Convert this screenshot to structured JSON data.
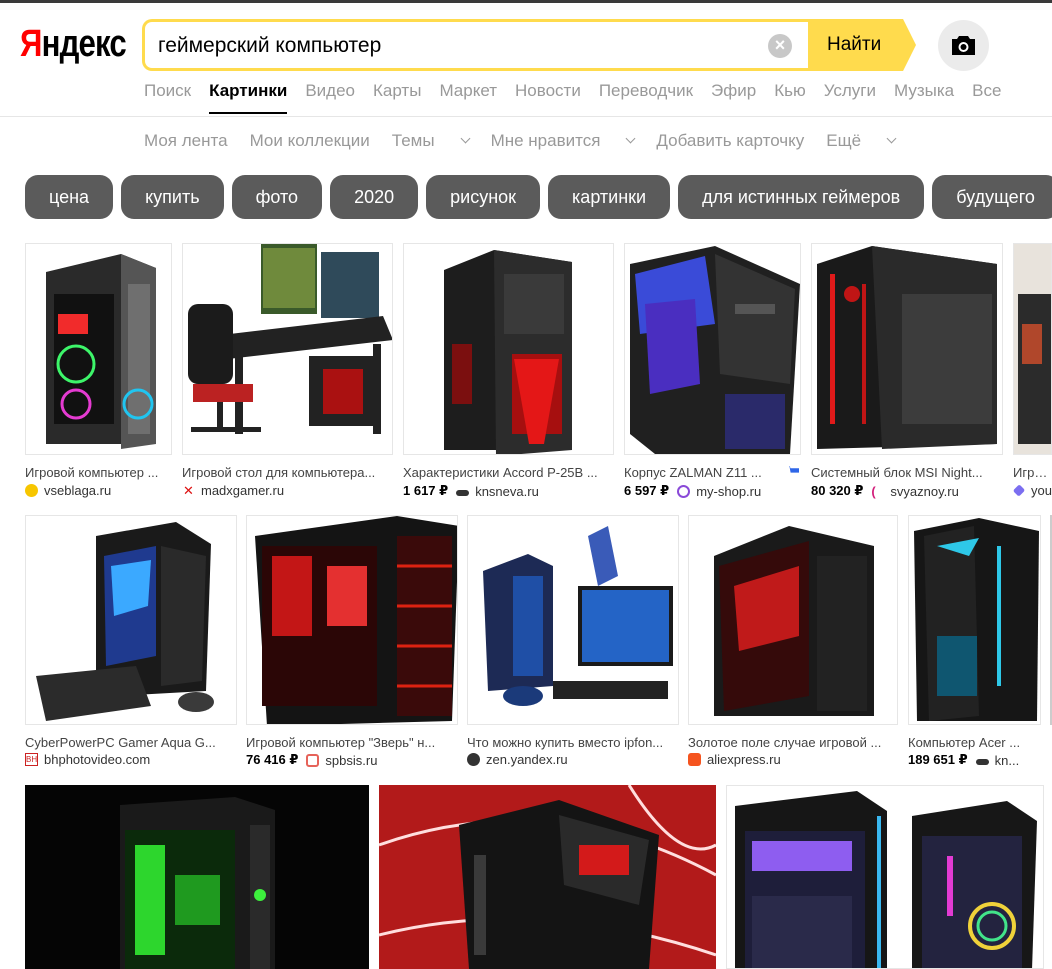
{
  "logo": {
    "first": "Я",
    "rest": "ндекс"
  },
  "search": {
    "query": "геймерский компьютер",
    "find_label": "Найти",
    "clear_glyph": "×"
  },
  "services": [
    "Поиск",
    "Картинки",
    "Видео",
    "Карты",
    "Маркет",
    "Новости",
    "Переводчик",
    "Эфир",
    "Кью",
    "Услуги",
    "Музыка",
    "Все"
  ],
  "subnav": {
    "feed": "Моя лента",
    "collections": "Мои коллекции",
    "themes": "Темы",
    "likes": "Мне нравится",
    "add_card": "Добавить карточку",
    "more": "Ещё"
  },
  "chips": [
    "цена",
    "купить",
    "фото",
    "2020",
    "рисунок",
    "картинки",
    "для истинных геймеров",
    "будущего"
  ],
  "images": {
    "r1c1": {
      "caption": "Игровой компьютер ...",
      "source": "vseblaga.ru"
    },
    "r1c2": {
      "caption": "Игровой стол для компьютера...",
      "source": "madxgamer.ru"
    },
    "r1c3": {
      "caption": "Характеристики Accord P-25B ...",
      "price": "1 617 ₽",
      "source": "knsneva.ru"
    },
    "r1c4": {
      "caption": "Корпус ZALMAN Z11 ...",
      "price": "6 597 ₽",
      "source": "my-shop.ru"
    },
    "r1c5": {
      "caption": "Системный блок MSI Night...",
      "price": "80 320 ₽",
      "source": "svyaznoy.ru"
    },
    "r1c6": {
      "caption": "Игрово",
      "source": "you"
    },
    "r2c1": {
      "caption": "CyberPowerPC Gamer Aqua G...",
      "source": "bhphotovideo.com",
      "fav_text": "BH"
    },
    "r2c2": {
      "caption": "Игровой компьютер \"Зверь\" н...",
      "price": "76 416 ₽",
      "source": "spbsis.ru"
    },
    "r2c3": {
      "caption": "Что можно купить вместо ipfon...",
      "source": "zen.yandex.ru"
    },
    "r2c4": {
      "caption": "Золотое поле случае игровой ...",
      "source": "aliexpress.ru"
    },
    "r2c5": {
      "caption": "Компьютер Acer ...",
      "price": "189 651 ₽",
      "source": "kn..."
    }
  },
  "colors": {
    "accent": "#ffdb4d",
    "chip_bg": "#5b5b5b",
    "logo_red": "#ff0000",
    "muted": "#999999"
  }
}
